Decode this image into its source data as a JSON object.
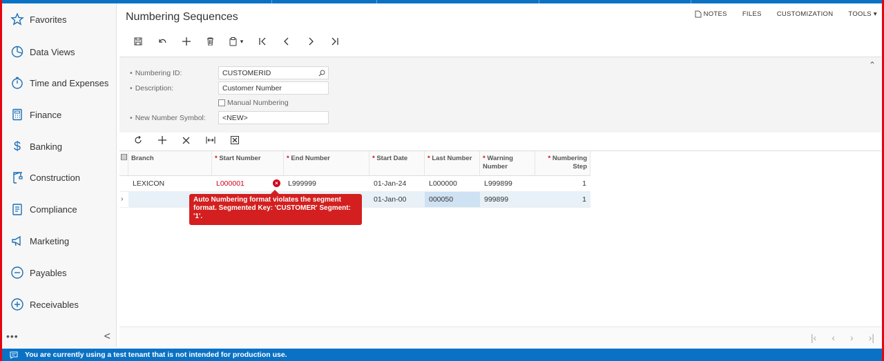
{
  "sidebar": {
    "items": [
      {
        "label": "Favorites",
        "icon": "star-icon"
      },
      {
        "label": "Data Views",
        "icon": "pie-chart-icon"
      },
      {
        "label": "Time and Expenses",
        "icon": "stopwatch-icon"
      },
      {
        "label": "Finance",
        "icon": "calculator-icon"
      },
      {
        "label": "Banking",
        "icon": "dollar-icon"
      },
      {
        "label": "Construction",
        "icon": "crane-icon"
      },
      {
        "label": "Compliance",
        "icon": "document-icon"
      },
      {
        "label": "Marketing",
        "icon": "megaphone-icon"
      },
      {
        "label": "Payables",
        "icon": "minus-circle-icon"
      },
      {
        "label": "Receivables",
        "icon": "plus-circle-icon"
      }
    ],
    "more": "•••",
    "collapse": "<"
  },
  "header": {
    "title": "Numbering Sequences",
    "links": [
      "NOTES",
      "FILES",
      "CUSTOMIZATION",
      "TOOLS"
    ]
  },
  "form": {
    "numbering_id_label": "Numbering ID:",
    "numbering_id_value": "CUSTOMERID",
    "description_label": "Description:",
    "description_value": "Customer Number",
    "manual_numbering_label": "Manual Numbering",
    "new_symbol_label": "New Number Symbol:",
    "new_symbol_value": "<NEW>"
  },
  "grid": {
    "columns": [
      "Branch",
      "Start Number",
      "End Number",
      "Start Date",
      "Last Number",
      "Warning Number",
      "Numbering Step"
    ],
    "rows": [
      {
        "branch": "LEXICON",
        "start": "L000001",
        "end": "L999999",
        "date": "01-Jan-24",
        "last": "L000000",
        "warning": "L999899",
        "step": "1"
      },
      {
        "branch": "",
        "start": "",
        "end": "",
        "date": "01-Jan-00",
        "last": "000050",
        "warning": "999899",
        "step": "1"
      }
    ],
    "error_tooltip": "Auto Numbering format violates the segment format. Segmented Key: 'CUSTOMER' Segment: '1'."
  },
  "status_bar": {
    "message": "You are currently using a test tenant that is not intended for production use."
  },
  "colors": {
    "accent": "#0a72c5",
    "error": "#d31f1f",
    "frame": "#e30613"
  }
}
